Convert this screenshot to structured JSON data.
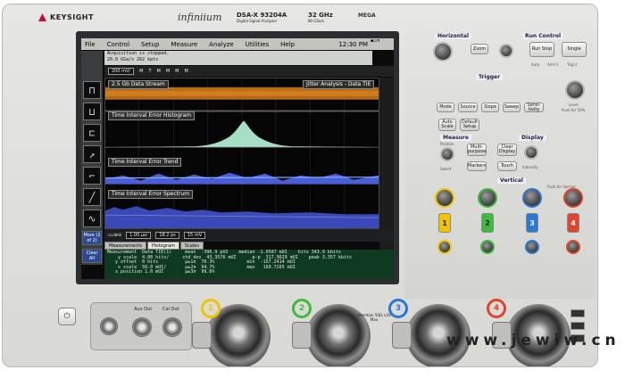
{
  "brand": {
    "name": "KEYSIGHT",
    "series": "infiniium",
    "model": "DSA-X 93204A",
    "model_sub": "Digital Signal Analyzer",
    "bandwidth": "32 GHz",
    "sample_rate": "80 GSa/s",
    "mega": "MEGA"
  },
  "menu": {
    "items": [
      "File",
      "Control",
      "Setup",
      "Measure",
      "Analyze",
      "Utilities",
      "Help"
    ],
    "clock": "12:30 PM"
  },
  "acq": {
    "line1": "Acquisition is stopped.",
    "line2": "20.0 GSa/s    262 kpts"
  },
  "channel_row": {
    "ch_scale": "200 mV/",
    "markers": [
      "M",
      "T",
      "M",
      "M",
      "M",
      "M"
    ]
  },
  "sidebar": {
    "labels": [
      "More (2 of 2)",
      "Clear All"
    ]
  },
  "traces": {
    "data_stream": "2.5 Gb Data Stream",
    "filter": "Jitter Analysis - Data TIE",
    "histogram": "Time Interval Error Histogram",
    "trend": "Time Interval Error Trend",
    "spectrum": "Time Interval Error Spectrum"
  },
  "controls": {
    "timebase": "1.00 μs/",
    "delay": "18.2 ps",
    "volt": "15 mV"
  },
  "tabs": [
    "Measurements",
    "Histogram",
    "Scales"
  ],
  "measurements": [
    "Measurement  Data TIE(1)     mean  -396.9 pUI    median -1.0507 mUI    hits 343.9 kbits",
    "    y scale  4.00 hits/     std dev  43.3576 mUI      p-p  317.9629 mUI    peak 3.357 kbits",
    "   y offset  0 hits          μ±1σ  70.3%            min  -157.2414 mUI",
    "    x scale  50.0 mUI/       μ±2σ  94.7%            max   160.7265 mUI",
    "   x position 1.0 mUI        μ±3σ  99.6%"
  ],
  "panel": {
    "horizontal": "Horizontal",
    "run_control": "Run Control",
    "zoom": "Zoom",
    "run_stop": "Run Stop",
    "single": "Single",
    "push_fine": "Push for Fine",
    "auto": "Auto",
    "arm": "Arm'd",
    "trigd": "Trig'd",
    "trigger": "Trigger",
    "mode": "Mode",
    "source": "Source",
    "slope": "Slope",
    "sweep": "Sweep",
    "sensitivity": "Sensi-tivity",
    "level": "Level",
    "push_50": "Push for 50%",
    "auto_scale": "Auto Scale",
    "default_setup": "Default Setup",
    "measure": "Measure",
    "display": "Display",
    "position": "Position",
    "multi_purpose": "Multi-purpose",
    "clear_display": "Clear Display",
    "markers": "Markers",
    "touch": "Touch",
    "select": "Select",
    "intensity": "Intensity",
    "vertical": "Vertical",
    "push_vernier": "Push for Vernier",
    "ch_labels": [
      "1",
      "2",
      "3",
      "4"
    ]
  },
  "front": {
    "aux_out": "Aux Out",
    "cal_out": "Cal Out",
    "attention": "Attention 50Ω ±5V Max",
    "inputs": [
      "1",
      "2",
      "3",
      "4"
    ]
  },
  "colors": {
    "ch1": "#f2c400",
    "ch2": "#3dbb3d",
    "ch3": "#2a78d6",
    "ch4": "#e0452b"
  },
  "watermark": "www.jewiw.cn"
}
